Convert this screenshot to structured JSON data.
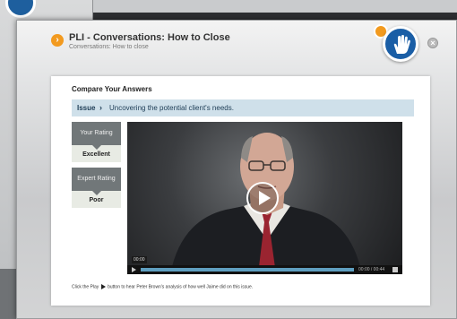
{
  "window": {
    "title": "PLI - Conversations: How to Close",
    "subtitle": "Conversations: How to close"
  },
  "card": {
    "title": "Compare Your Answers",
    "issue_label": "Issue",
    "issue_arrow": "›",
    "issue_text": "Uncovering the potential client's needs."
  },
  "ratings": {
    "your_label": "Your Rating",
    "your_value": "Excellent",
    "expert_label": "Expert Rating",
    "expert_value": "Poor"
  },
  "video": {
    "time_start": "00:00",
    "time_total": "00:00 / 00:44",
    "progress": 0.0
  },
  "instructions": {
    "before": "Click the Play",
    "after": "button to hear Peter Brown's analysis of how well Jaime did on this issue."
  },
  "icons": {
    "back": "chevron-right-icon",
    "hand": "hand-icon",
    "close": "close-icon",
    "play": "play-icon",
    "volume": "volume-icon"
  },
  "colors": {
    "accent_orange": "#f29a1f",
    "badge_blue": "#1a5ea6",
    "issue_bg": "#cfe0ea",
    "rating_head": "#717779",
    "progress": "#5f9fc0"
  }
}
